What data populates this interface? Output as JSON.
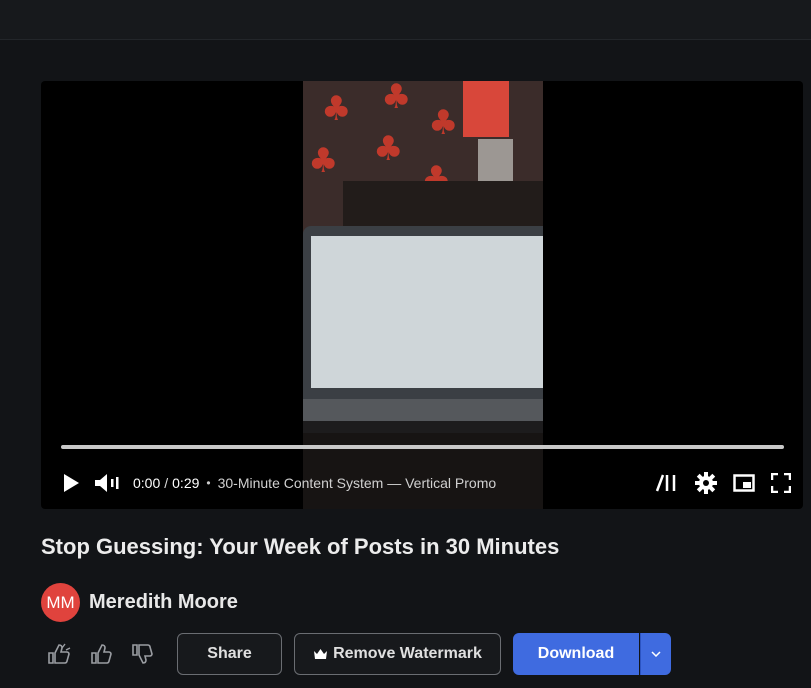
{
  "player": {
    "time_current": "0:00",
    "time_separator": "/",
    "time_total": "0:29",
    "bullet": "•",
    "video_title": "30-Minute Content System — Vertical Promo",
    "progress": 0
  },
  "video": {
    "title": "Stop Guessing: Your Week of Posts in 30 Minutes"
  },
  "author": {
    "initials": "MM",
    "name": "Meredith Moore",
    "avatar_color": "#e0433d"
  },
  "actions": {
    "share_label": "Share",
    "remove_watermark_label": "Remove Watermark",
    "download_label": "Download"
  },
  "icons": [
    "super-like-icon",
    "like-icon",
    "dislike-icon",
    "play-icon",
    "volume-icon",
    "chapters-icon",
    "settings-icon",
    "miniplayer-icon",
    "fullscreen-icon",
    "crown-icon",
    "chevron-down-icon"
  ],
  "colors": {
    "accent": "#3f6be0",
    "background": "#121417"
  }
}
